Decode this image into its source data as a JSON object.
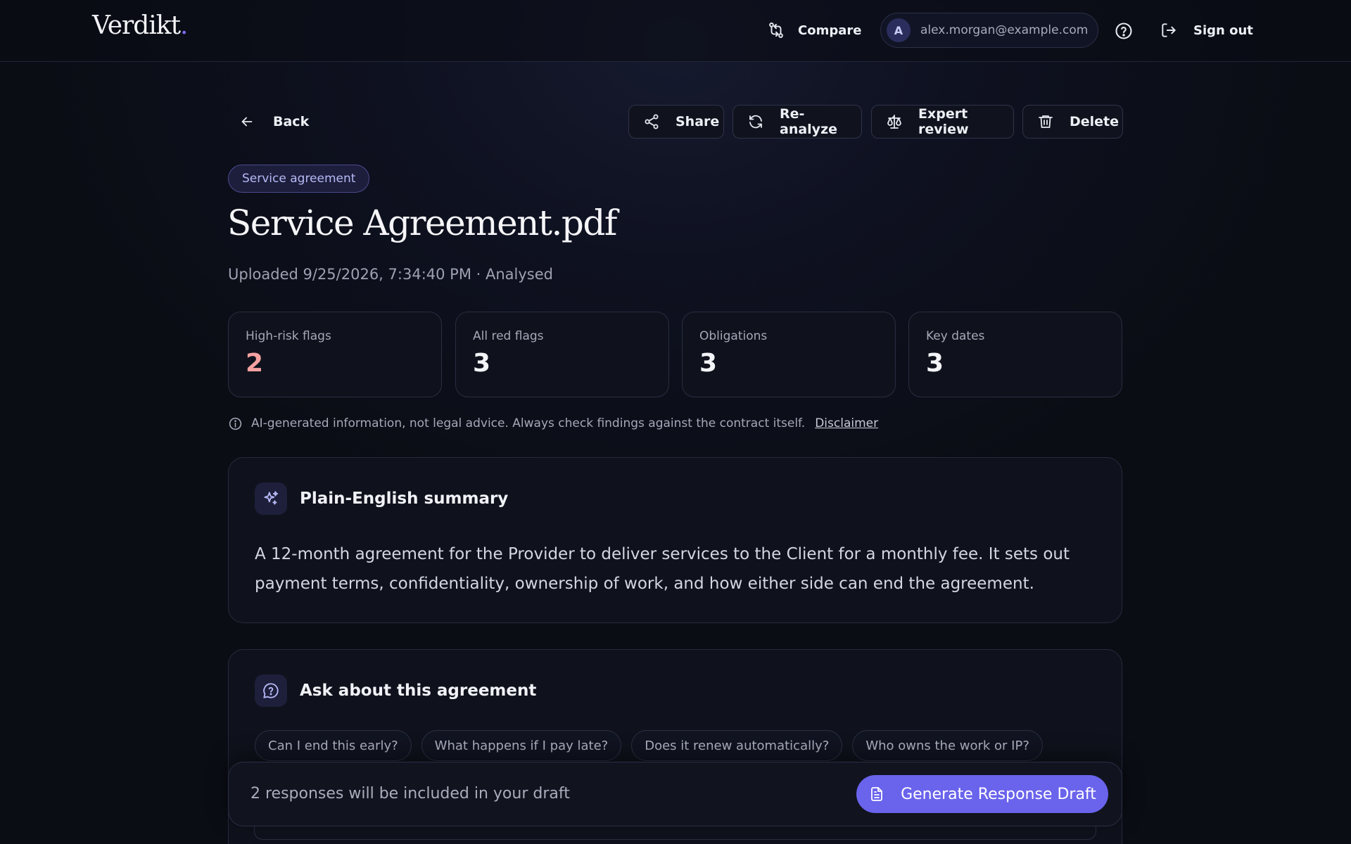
{
  "header": {
    "logo_text": "Verdikt",
    "logo_dot": ".",
    "compare_label": "Compare",
    "avatar_initial": "A",
    "user_email": "alex.morgan@example.com",
    "signout_label": "Sign out"
  },
  "toolbar": {
    "back_label": "Back",
    "share_label": "Share",
    "reanalyze_label": "Re-analyze",
    "expert_review_label": "Expert review",
    "delete_label": "Delete"
  },
  "document": {
    "tag": "Service agreement",
    "title": "Service Agreement.pdf",
    "subtitle": "Uploaded 9/25/2026, 7:34:40 PM · Analysed"
  },
  "stats": [
    {
      "label": "High-risk flags",
      "value": "2"
    },
    {
      "label": "All red flags",
      "value": "3"
    },
    {
      "label": "Obligations",
      "value": "3"
    },
    {
      "label": "Key dates",
      "value": "3"
    }
  ],
  "disclaimer": {
    "text": "AI-generated information, not legal advice. Always check findings against the contract itself.",
    "link": "Disclaimer"
  },
  "summary": {
    "title": "Plain-English summary",
    "body": "A 12-month agreement for the Provider to deliver services to the Client for a monthly fee. It sets out payment terms, confidentiality, ownership of work, and how either side can end the agreement."
  },
  "ask": {
    "title": "Ask about this agreement",
    "chips": [
      "Can I end this early?",
      "What happens if I pay late?",
      "Does it renew automatically?",
      "Who owns the work or IP?"
    ]
  },
  "draft": {
    "status": "2 responses will be included in your draft",
    "button": "Generate Response Draft"
  },
  "colors": {
    "accent": "#6a63ec",
    "risk": "#f6a1a1",
    "logo_dot": "#7c6df2"
  }
}
